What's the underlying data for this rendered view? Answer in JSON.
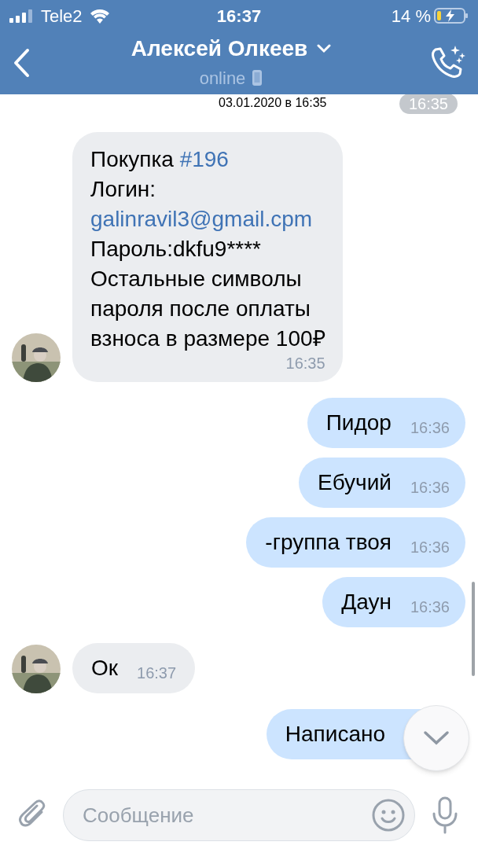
{
  "status_bar": {
    "carrier": "Tele2",
    "time": "16:37",
    "battery": "14 %",
    "charging": true
  },
  "header": {
    "title": "Алексей Олкеев",
    "status": "online"
  },
  "date_separator": "03.01.2020 в 16:35",
  "time_pill": "16:35",
  "messages": [
    {
      "kind": "incoming",
      "time": "16:35",
      "parts": [
        {
          "kind": "text",
          "text": "Покупка "
        },
        {
          "kind": "link",
          "text": "#196"
        },
        {
          "kind": "text",
          "text": "\nЛогин:\n"
        },
        {
          "kind": "link",
          "text": "galinravil3@gmail.cpm"
        },
        {
          "kind": "text",
          "text": "\nПароль:dkfu9****\nОстальные символы\nпароля после оплаты\nвзноса в размере 100₽"
        }
      ]
    },
    {
      "kind": "outgoing",
      "time": "16:36",
      "parts": [
        {
          "kind": "text",
          "text": "Пидор"
        }
      ]
    },
    {
      "kind": "outgoing",
      "time": "16:36",
      "parts": [
        {
          "kind": "text",
          "text": "Ебучий"
        }
      ]
    },
    {
      "kind": "outgoing",
      "time": "16:36",
      "parts": [
        {
          "kind": "text",
          "text": "-группа твоя"
        }
      ]
    },
    {
      "kind": "outgoing",
      "time": "16:36",
      "parts": [
        {
          "kind": "text",
          "text": "Даун"
        }
      ]
    },
    {
      "kind": "incoming",
      "time": "16:37",
      "parts": [
        {
          "kind": "text",
          "text": "Ок"
        }
      ]
    },
    {
      "kind": "outgoing",
      "parts": [
        {
          "kind": "text",
          "text": "Написано"
        }
      ]
    }
  ],
  "composer": {
    "placeholder": "Сообщение"
  }
}
